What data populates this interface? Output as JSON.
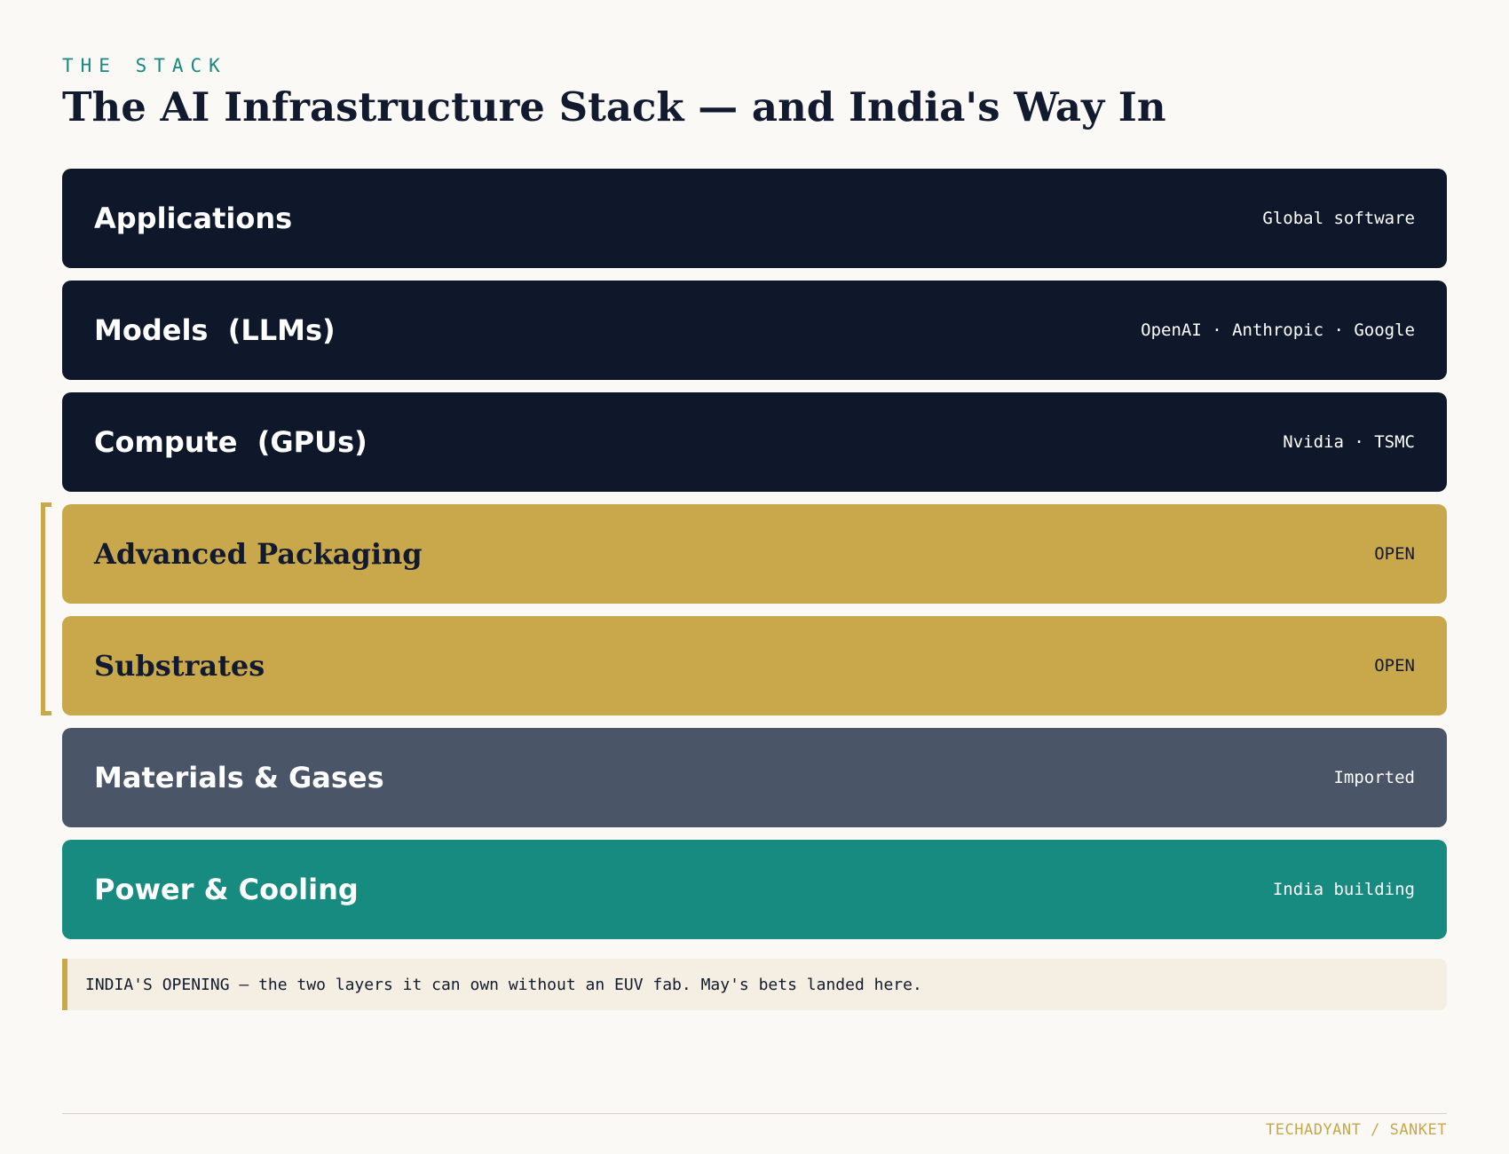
{
  "header": {
    "eyebrow": "THE STACK",
    "title": "The AI Infrastructure Stack — and India's Way In"
  },
  "layers": [
    {
      "name": "Applications",
      "tag": "Global software",
      "style": "dark"
    },
    {
      "name": "Models  (LLMs)",
      "tag": "OpenAI · Anthropic · Google",
      "style": "dark"
    },
    {
      "name": "Compute  (GPUs)",
      "tag": "Nvidia · TSMC",
      "style": "dark"
    },
    {
      "name": "Advanced Packaging",
      "tag": "OPEN",
      "style": "gold"
    },
    {
      "name": "Substrates",
      "tag": "OPEN",
      "style": "gold"
    },
    {
      "name": "Materials & Gases",
      "tag": "Imported",
      "style": "slate"
    },
    {
      "name": "Power & Cooling",
      "tag": "India building",
      "style": "teal"
    }
  ],
  "callout": {
    "text": "INDIA'S OPENING — the two layers it can own without an EUV fab. May's bets landed here."
  },
  "footer": {
    "credit": "TECHADYANT / SANKET"
  },
  "colors": {
    "dark": "#0f172a",
    "gold": "#c9a74b",
    "slate": "#4a5568",
    "teal": "#178b7f",
    "background": "#faf9f5"
  }
}
